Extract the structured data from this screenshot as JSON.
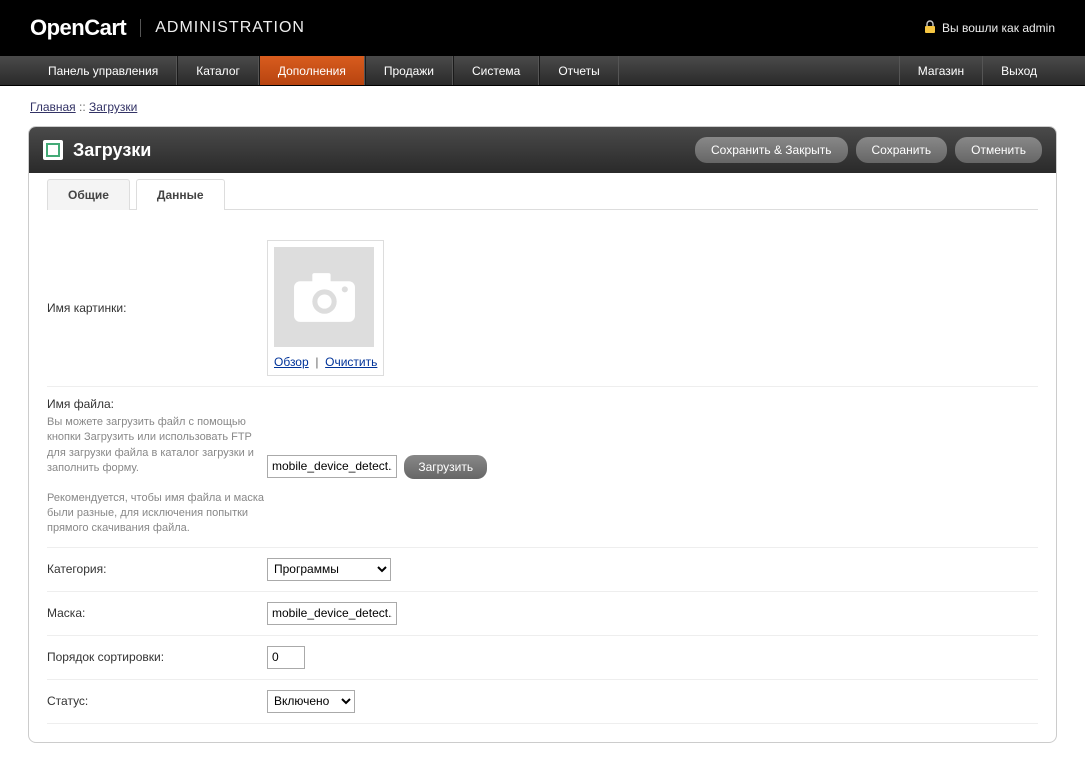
{
  "header": {
    "brand": "OpenCart",
    "admin_label": "ADMINISTRATION",
    "login_text": "Вы вошли как admin"
  },
  "nav": {
    "left": [
      "Панель управления",
      "Каталог",
      "Дополнения",
      "Продажи",
      "Система",
      "Отчеты"
    ],
    "right": [
      "Магазин",
      "Выход"
    ],
    "active_index": 2
  },
  "breadcrumb": {
    "home": "Главная",
    "sep": " :: ",
    "current": "Загрузки"
  },
  "box": {
    "title": "Загрузки",
    "actions": {
      "save_close": "Сохранить & Закрыть",
      "save": "Сохранить",
      "cancel": "Отменить"
    }
  },
  "tabs": {
    "general": "Общие",
    "data": "Данные"
  },
  "form": {
    "image_label": "Имя картинки:",
    "image_browse": "Обзор",
    "image_clear": "Очистить",
    "file_label": "Имя файла:",
    "file_help1": "Вы можете загрузить файл с помощью кнопки Загрузить или использовать FTP для загрузки файла в каталог загрузки и заполнить форму.",
    "file_help2": "Рекомендуется, чтобы имя файла и маска были разные, для исключения попытки прямого скачивания файла.",
    "file_value": "mobile_device_detect.z",
    "upload_btn": "Загрузить",
    "category_label": "Категория:",
    "category_value": "Программы",
    "mask_label": "Маска:",
    "mask_value": "mobile_device_detect.z",
    "sort_label": "Порядок сортировки:",
    "sort_value": "0",
    "status_label": "Статус:",
    "status_value": "Включено"
  }
}
